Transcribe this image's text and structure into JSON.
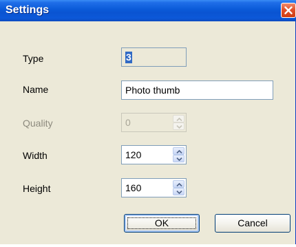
{
  "window": {
    "title": "Settings"
  },
  "form": {
    "type": {
      "label": "Type",
      "value": "3"
    },
    "name": {
      "label": "Name",
      "value": "Photo thumb"
    },
    "quality": {
      "label": "Quality",
      "value": "0"
    },
    "width": {
      "label": "Width",
      "value": "120"
    },
    "height": {
      "label": "Height",
      "value": "160"
    }
  },
  "buttons": {
    "ok": "OK",
    "cancel": "Cancel"
  },
  "icons": {
    "close": "close-icon",
    "spin_up": "chevron-up-icon",
    "spin_down": "chevron-down-icon"
  },
  "colors": {
    "titlebar": "#0a54d2",
    "dialog_bg": "#ece9d8",
    "close_button": "#e2512a",
    "selection": "#316ac5"
  }
}
